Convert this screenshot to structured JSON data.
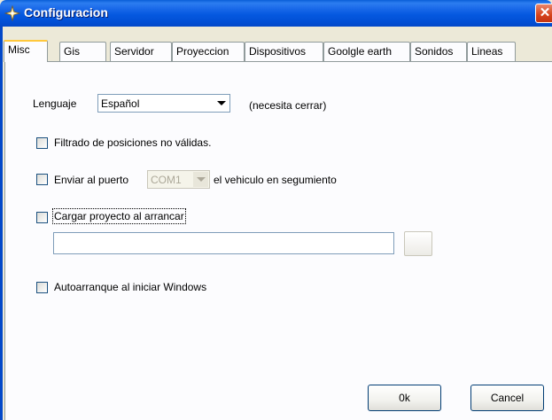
{
  "window": {
    "title": "Configuracion",
    "close_glyph": "✕"
  },
  "tabs": [
    {
      "label": "Misc",
      "active": true
    },
    {
      "label": "Gis"
    },
    {
      "label": "Servidor"
    },
    {
      "label": "Proyeccion"
    },
    {
      "label": "Dispositivos"
    },
    {
      "label": "Goolgle earth"
    },
    {
      "label": "Sonidos"
    },
    {
      "label": "Lineas"
    }
  ],
  "misc": {
    "language_label": "Lenguaje",
    "language_value": "Español",
    "language_note": "(necesita cerrar)",
    "filter_label": "Filtrado de posiciones no válidas.",
    "filter_checked": false,
    "send_port_label": "Enviar al puerto",
    "send_port_value": "COM1",
    "send_port_suffix": "el vehiculo en segumiento",
    "send_port_checked": false,
    "load_project_label": "Cargar proyecto al arrancar",
    "load_project_checked": false,
    "project_path": "",
    "autostart_label": "Autoarranque al iniciar Windows",
    "autostart_checked": false
  },
  "buttons": {
    "ok": "0k",
    "cancel": "Cancel"
  },
  "icons": {
    "title": "gear-star-icon",
    "close": "close-icon",
    "dropdown": "chevron-down-icon"
  }
}
